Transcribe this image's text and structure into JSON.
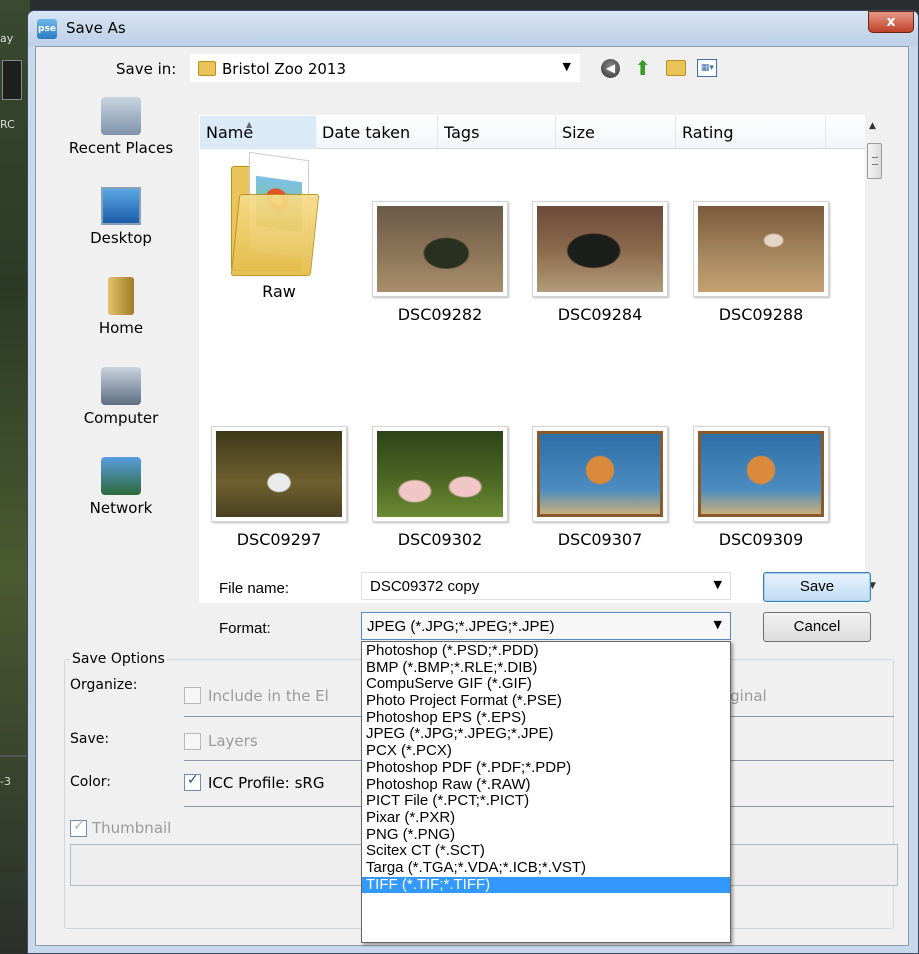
{
  "background_app": {
    "fragments": [
      "ay",
      "RC",
      "-3"
    ]
  },
  "dialog": {
    "title": "Save As",
    "app_icon_text": "pse",
    "close_glyph": "x"
  },
  "save_in": {
    "label": "Save in:",
    "value": "Bristol Zoo 2013",
    "icons": [
      "back-icon",
      "up-folder-icon",
      "new-folder-icon",
      "views-menu-icon"
    ]
  },
  "places": [
    {
      "label": "Recent Places",
      "icon": "recent-places-icon"
    },
    {
      "label": "Desktop",
      "icon": "desktop-icon"
    },
    {
      "label": "Home",
      "icon": "home-icon"
    },
    {
      "label": "Computer",
      "icon": "computer-icon"
    },
    {
      "label": "Network",
      "icon": "network-icon"
    }
  ],
  "columns": [
    "Name",
    "Date taken",
    "Tags",
    "Size",
    "Rating"
  ],
  "files": [
    {
      "name": "Raw",
      "kind": "folder"
    },
    {
      "name": "DSC09282",
      "kind": "image",
      "image": "gorilla-statue"
    },
    {
      "name": "DSC09284",
      "kind": "image",
      "image": "gorilla-statue"
    },
    {
      "name": "DSC09288",
      "kind": "image",
      "image": "flamingo"
    },
    {
      "name": "DSC09297",
      "kind": "image",
      "image": "egret"
    },
    {
      "name": "DSC09302",
      "kind": "image",
      "image": "flamingos"
    },
    {
      "name": "DSC09307",
      "kind": "image",
      "image": "zoo-sign"
    },
    {
      "name": "DSC09309",
      "kind": "image",
      "image": "zoo-sign"
    }
  ],
  "file_name": {
    "label": "File name:",
    "value": "DSC09372 copy"
  },
  "format": {
    "label": "Format:",
    "value": "JPEG (*.JPG;*.JPEG;*.JPE)",
    "options": [
      "Photoshop (*.PSD;*.PDD)",
      "BMP (*.BMP;*.RLE;*.DIB)",
      "CompuServe GIF (*.GIF)",
      "Photo Project Format (*.PSE)",
      "Photoshop EPS (*.EPS)",
      "JPEG (*.JPG;*.JPEG;*.JPE)",
      "PCX (*.PCX)",
      "Photoshop PDF (*.PDF;*.PDP)",
      "Photoshop Raw (*.RAW)",
      "PICT File (*.PCT;*.PICT)",
      "Pixar (*.PXR)",
      "PNG (*.PNG)",
      "Scitex CT (*.SCT)",
      "Targa (*.TGA;*.VDA;*.ICB;*.VST)",
      "TIFF (*.TIF;*.TIFF)"
    ],
    "highlighted": "TIFF (*.TIF;*.TIFF)"
  },
  "buttons": {
    "save": "Save",
    "cancel": "Cancel"
  },
  "save_options": {
    "title": "Save Options",
    "organize_label": "Organize:",
    "organize_checkbox": "Include in the El",
    "organize_tail": "Original",
    "save_label": "Save:",
    "layers_checkbox": "Layers",
    "color_label": "Color:",
    "icc_checkbox": "ICC Profile:  sRG",
    "thumbnail_checkbox": "Thumbnail"
  }
}
